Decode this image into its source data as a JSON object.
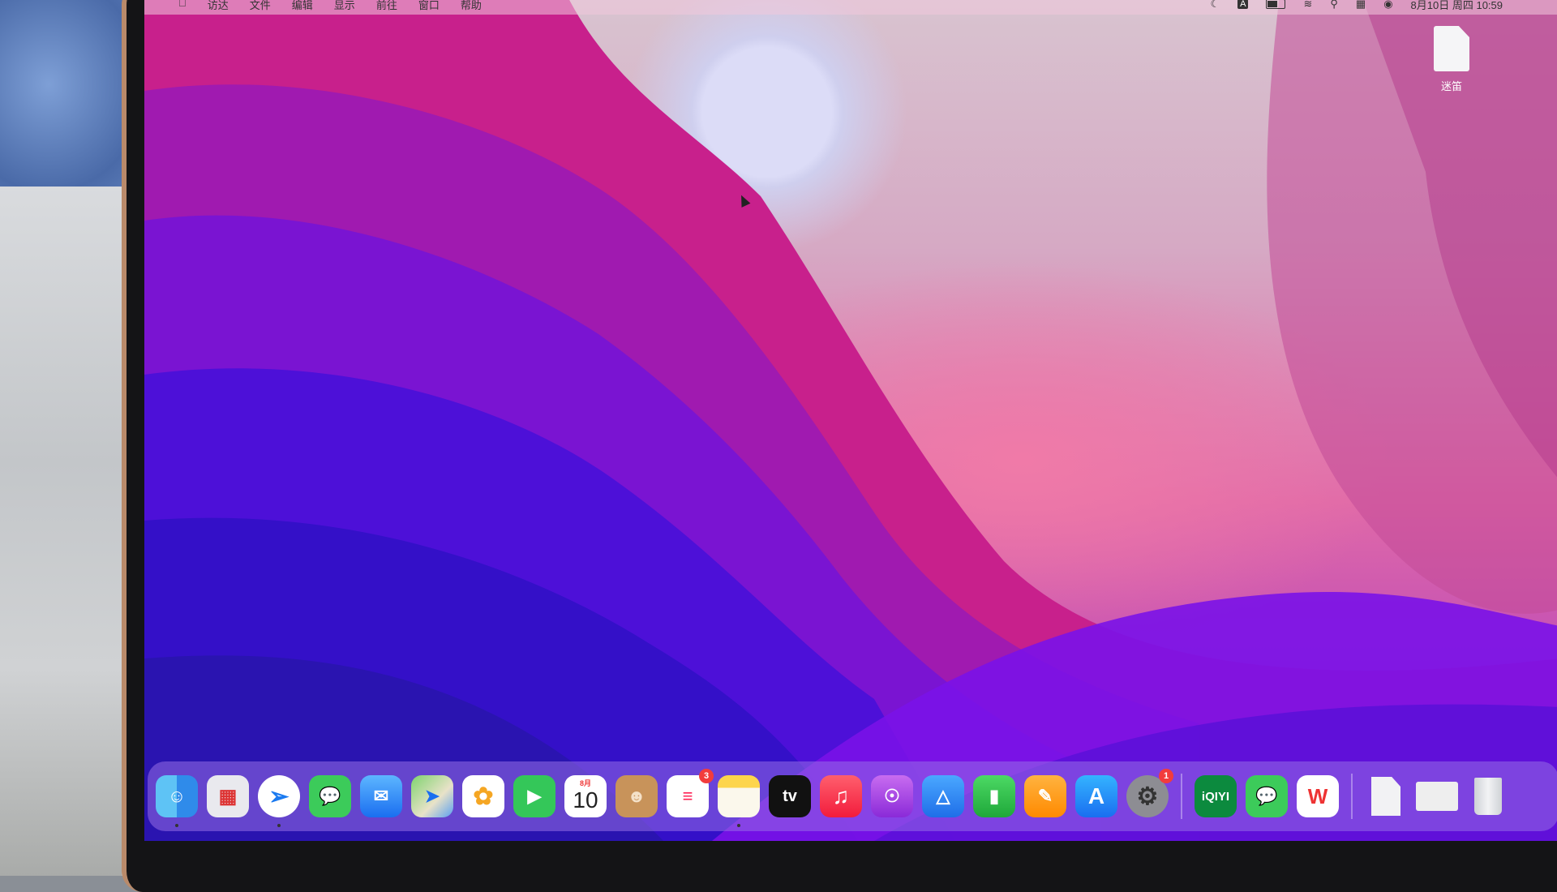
{
  "menubar": {
    "items": [
      "访达",
      "文件",
      "编辑",
      "显示",
      "前往",
      "窗口",
      "帮助"
    ],
    "clock": "8月10日 周四  10:59",
    "input_indicator": "A"
  },
  "desktop": {
    "file_label": "迷笛"
  },
  "dock": {
    "apps": [
      {
        "name": "Finder",
        "icon": "finder-icon"
      },
      {
        "name": "Launchpad",
        "icon": "launchpad-icon"
      },
      {
        "name": "Safari",
        "icon": "safari-icon"
      },
      {
        "name": "Messages",
        "icon": "messages-icon"
      },
      {
        "name": "Mail",
        "icon": "mail-icon"
      },
      {
        "name": "Maps",
        "icon": "maps-icon"
      },
      {
        "name": "Photos",
        "icon": "photos-icon"
      },
      {
        "name": "FaceTime",
        "icon": "facetime-icon"
      },
      {
        "name": "Calendar",
        "icon": "calendar-icon",
        "month": "8月",
        "day": "10"
      },
      {
        "name": "Contacts",
        "icon": "contacts-icon"
      },
      {
        "name": "Reminders",
        "icon": "reminders-icon",
        "badge": "3"
      },
      {
        "name": "Notes",
        "icon": "notes-icon"
      },
      {
        "name": "TV",
        "icon": "tv-icon",
        "label": "tv"
      },
      {
        "name": "Music",
        "icon": "music-icon"
      },
      {
        "name": "Podcasts",
        "icon": "podcasts-icon"
      },
      {
        "name": "Keynote",
        "icon": "keynote-icon"
      },
      {
        "name": "Numbers",
        "icon": "numbers-icon"
      },
      {
        "name": "Pages",
        "icon": "pages-icon"
      },
      {
        "name": "App Store",
        "icon": "appstore-icon"
      },
      {
        "name": "System Settings",
        "icon": "settings-icon",
        "badge": "1"
      },
      {
        "name": "iQIYI",
        "icon": "iqiyi-icon",
        "label": "iQIYI"
      },
      {
        "name": "WeChat",
        "icon": "wechat-icon"
      },
      {
        "name": "WPS Office",
        "icon": "wps-icon",
        "label": "W"
      },
      {
        "name": "Document",
        "icon": "document-icon"
      },
      {
        "name": "Screen",
        "icon": "screen-icon"
      },
      {
        "name": "Trash",
        "icon": "trash-icon"
      }
    ]
  },
  "colors": {
    "wallpaper_top": "#d8c4d0",
    "wallpaper_dark": "#3a10d0",
    "dock_bg": "#9670e6",
    "badge": "#f23c3c"
  }
}
